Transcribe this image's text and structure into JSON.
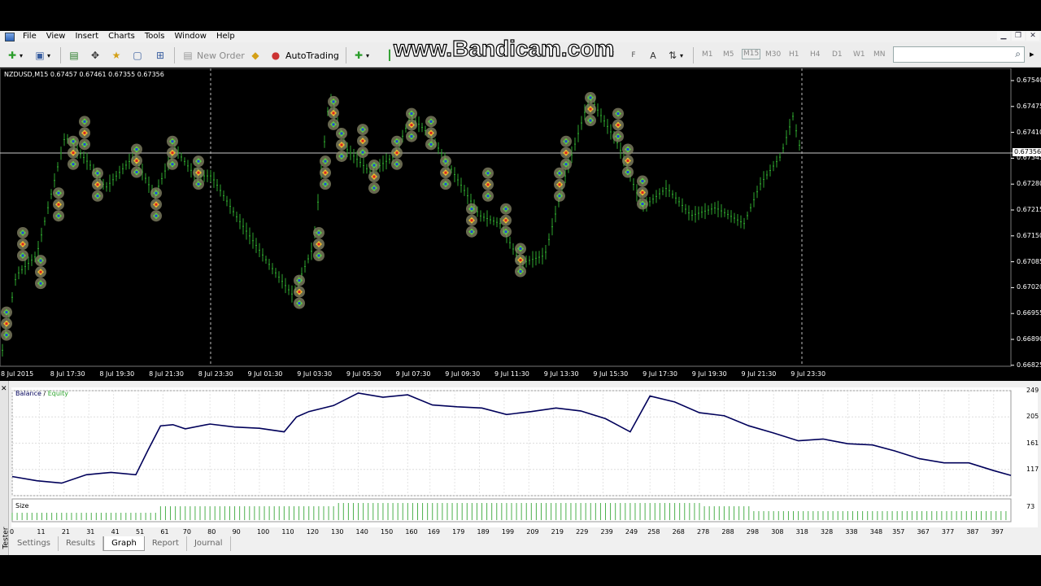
{
  "menu": [
    "File",
    "View",
    "Insert",
    "Charts",
    "Tools",
    "Window",
    "Help"
  ],
  "toolbar": {
    "new_order": "New Order",
    "autotrading": "AutoTrading",
    "timeframes": [
      "M1",
      "M5",
      "M15",
      "M30",
      "H1",
      "H4",
      "D1",
      "W1",
      "MN"
    ],
    "active_timeframe": "M15"
  },
  "watermark": "www.Bandicam.com",
  "chart": {
    "info": "NZDUSD,M15  0.67457 0.67461 0.67355 0.67356",
    "current_price": "0.67356",
    "price_labels": [
      "0.67540",
      "0.67475",
      "0.67410",
      "0.67345",
      "0.67280",
      "0.67215",
      "0.67150",
      "0.67085",
      "0.67020",
      "0.66955",
      "0.66890",
      "0.66825"
    ],
    "time_labels": [
      "8 Jul 2015",
      "8 Jul 17:30",
      "8 Jul 19:30",
      "8 Jul 21:30",
      "8 Jul 23:30",
      "9 Jul 01:30",
      "9 Jul 03:30",
      "9 Jul 05:30",
      "9 Jul 07:30",
      "9 Jul 09:30",
      "9 Jul 11:30",
      "9 Jul 13:30",
      "9 Jul 15:30",
      "9 Jul 17:30",
      "9 Jul 19:30",
      "9 Jul 21:30",
      "9 Jul 23:30"
    ]
  },
  "tester": {
    "side_label": "Tester",
    "close": "✕",
    "legend_balance": "Balance",
    "legend_sep": " / ",
    "legend_equity": "Equity",
    "size_label": "Size",
    "y_labels": [
      "249",
      "205",
      "161",
      "117",
      "73"
    ],
    "x_labels": [
      "0",
      "11",
      "21",
      "31",
      "41",
      "51",
      "61",
      "70",
      "80",
      "90",
      "100",
      "110",
      "120",
      "130",
      "140",
      "150",
      "160",
      "169",
      "179",
      "189",
      "199",
      "209",
      "219",
      "229",
      "239",
      "249",
      "258",
      "268",
      "278",
      "288",
      "298",
      "308",
      "318",
      "328",
      "338",
      "348",
      "357",
      "367",
      "377",
      "387",
      "397"
    ],
    "tabs": [
      "Settings",
      "Results",
      "Graph",
      "Report",
      "Journal"
    ],
    "active_tab": "Graph"
  },
  "chart_data": {
    "type": "line",
    "title": "",
    "series": [
      {
        "name": "Balance",
        "x": [
          0,
          10,
          20,
          30,
          40,
          50,
          55,
          60,
          65,
          70,
          80,
          90,
          100,
          110,
          115,
          120,
          130,
          140,
          150,
          160,
          170,
          180,
          190,
          200,
          210,
          220,
          230,
          240,
          250,
          258,
          268,
          278,
          288,
          298,
          308,
          318,
          328,
          338,
          348,
          357,
          367,
          377,
          387,
          397,
          404
        ],
        "values": [
          105,
          98,
          94,
          108,
          112,
          108,
          150,
          190,
          192,
          185,
          193,
          188,
          186,
          180,
          205,
          214,
          224,
          245,
          238,
          242,
          225,
          222,
          220,
          209,
          214,
          220,
          215,
          202,
          180,
          240,
          230,
          212,
          207,
          190,
          178,
          165,
          168,
          160,
          158,
          148,
          135,
          128,
          128,
          115,
          107
        ]
      }
    ],
    "ylim": [
      73,
      249
    ],
    "size_note": ""
  },
  "colors": {
    "bull": "#2ea52e",
    "balance_line": "#00005a",
    "size_bar": "#4cb04c",
    "price_line": "#ffffff"
  }
}
